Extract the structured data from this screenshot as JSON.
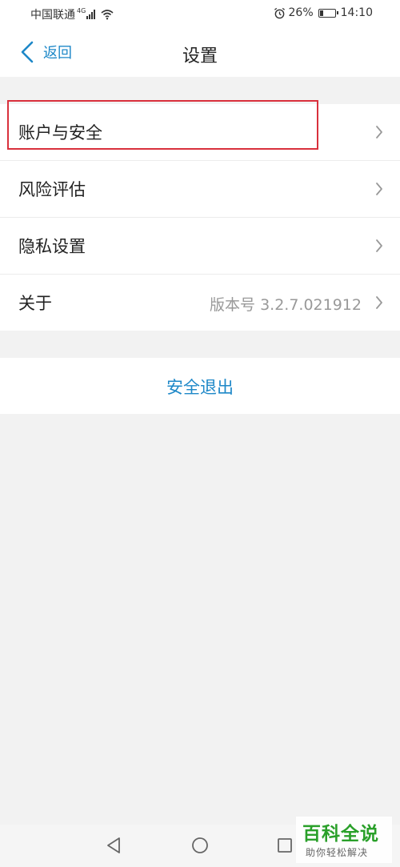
{
  "status_bar": {
    "carrier": "中国联通",
    "network": "4G",
    "battery_percent": "26%",
    "battery_level": 0.26,
    "time": "14:10",
    "icons": [
      "signal-icon",
      "wifi-icon",
      "alarm-icon",
      "battery-icon"
    ]
  },
  "nav": {
    "back_label": "返回",
    "title": "设置"
  },
  "settings": {
    "items": [
      {
        "label": "账户与安全",
        "value": ""
      },
      {
        "label": "风险评估",
        "value": ""
      },
      {
        "label": "隐私设置",
        "value": ""
      },
      {
        "label": "关于",
        "value": "版本号 3.2.7.021912"
      }
    ]
  },
  "logout": {
    "label": "安全退出"
  },
  "system_nav": {
    "icons": [
      "back-triangle-icon",
      "home-circle-icon",
      "recents-square-icon"
    ]
  },
  "watermark": {
    "title": "百科全说",
    "subtitle": "助你轻松解决"
  },
  "colors": {
    "accent": "#1e88c8",
    "highlight": "#d9303c",
    "background": "#f2f2f2"
  }
}
